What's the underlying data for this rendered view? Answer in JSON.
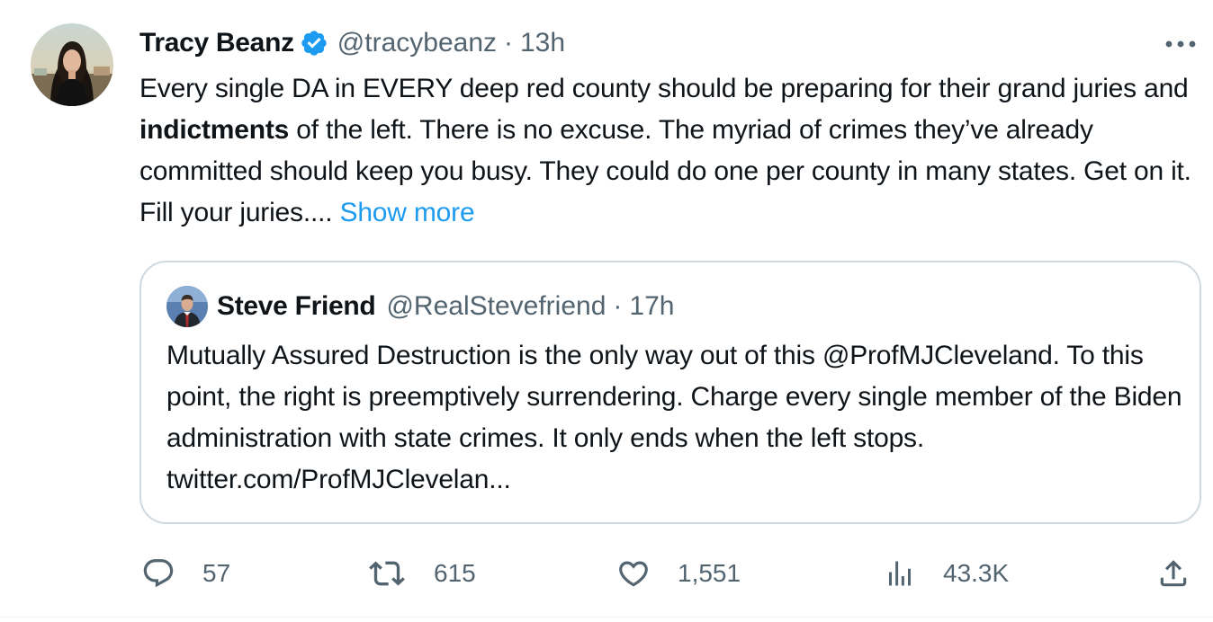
{
  "tweet": {
    "author_name": "Tracy Beanz",
    "handle": "@tracybeanz",
    "separator": "·",
    "time": "13h",
    "text_part1": "Every single DA in EVERY deep red county should be preparing for their grand juries and ",
    "text_bold": "indictments",
    "text_part2": " of the left. There is no excuse. The myriad of crimes  they’ve already committed should keep you busy. They could do one per county in many states. Get on it. Fill your juries.... ",
    "show_more": "Show more",
    "verified_icon": "verified-badge-icon",
    "more_icon": "more-dots-icon"
  },
  "quote": {
    "author_name": "Steve Friend",
    "handle": "@RealStevefriend",
    "separator": "·",
    "time": "17h",
    "text": "Mutually Assured Destruction is the only way out of this @ProfMJCleveland. To this point, the right is preemptively surrendering. Charge every single member of the Biden administration with state crimes. It only ends when the left stops. twitter.com/ProfMJClevelan..."
  },
  "actions": {
    "replies": "57",
    "retweets": "615",
    "likes": "1,551",
    "views": "43.3K"
  },
  "colors": {
    "accent": "#1d9bf0",
    "text": "#0f1419",
    "muted": "#536471",
    "border": "#cfd9de"
  }
}
